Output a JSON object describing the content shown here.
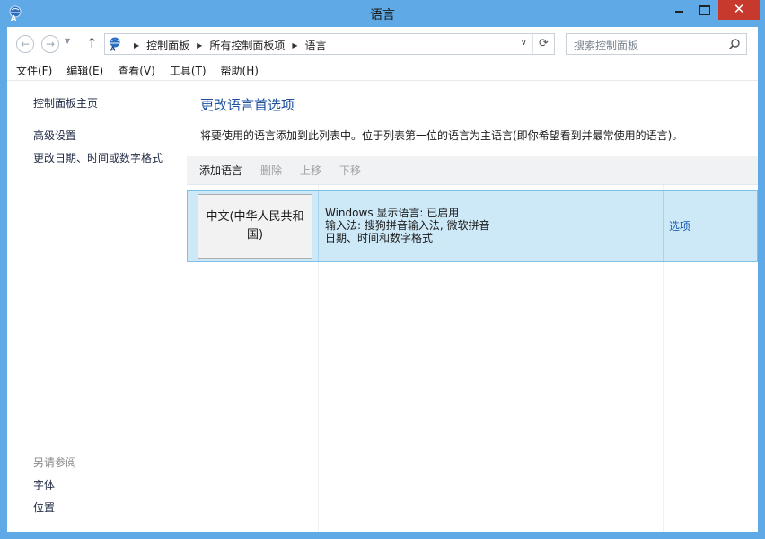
{
  "window": {
    "title": "语言"
  },
  "title_buttons": {
    "close": "✕"
  },
  "address_bar": {
    "breadcrumbs": [
      "控制面板",
      "所有控制面板项",
      "语言"
    ]
  },
  "search": {
    "placeholder": "搜索控制面板"
  },
  "menu": [
    "文件(F)",
    "编辑(E)",
    "查看(V)",
    "工具(T)",
    "帮助(H)"
  ],
  "left_nav": {
    "home": "控制面板主页",
    "advanced": "高级设置",
    "date_format": "更改日期、时间或数字格式",
    "see_also_label": "另请参阅",
    "fonts": "字体",
    "location": "位置"
  },
  "main": {
    "heading": "更改语言首选项",
    "description": "将要使用的语言添加到此列表中。位于列表第一位的语言为主语言(即你希望看到并最常使用的语言)。",
    "toolbar": {
      "add": "添加语言",
      "remove": "删除",
      "up": "上移",
      "down": "下移"
    },
    "languages": [
      {
        "name": "中文(中华人民共和国)",
        "display_status": "Windows 显示语言: 已启用",
        "input_methods": "输入法: 搜狗拼音输入法, 微软拼音",
        "formats": "日期、时间和数字格式",
        "options": "选项"
      }
    ]
  },
  "colors": {
    "title_bar": "#5fa9e6",
    "close_button": "#c7392c",
    "selected_row": "#cde8f7",
    "heading": "#1c4fa0",
    "link": "#1c5fb0"
  }
}
